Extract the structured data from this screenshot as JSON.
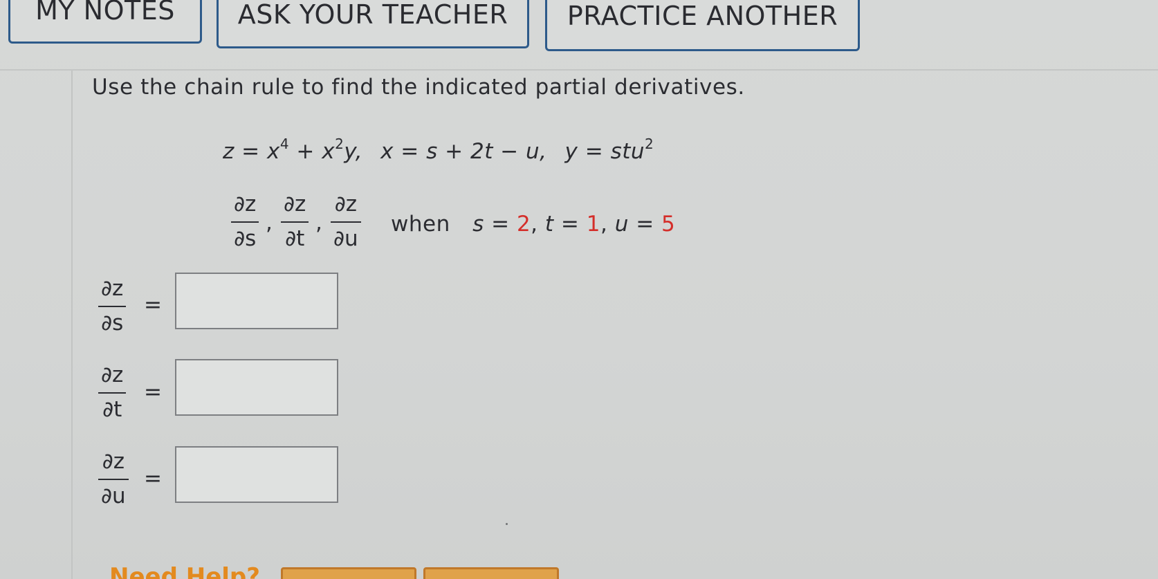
{
  "toolbar": {
    "my_notes": "MY NOTES",
    "ask_teacher": "ASK YOUR TEACHER",
    "practice_another": "PRACTICE ANOTHER"
  },
  "problem": {
    "prompt": "Use the chain rule to find the indicated partial derivatives.",
    "equations": {
      "z_def_lhs": "z = x",
      "z_exp1": "4",
      "z_mid": " + x",
      "z_exp2": "2",
      "z_end": "y,",
      "x_def": "x = s + 2t − u,",
      "y_def": "y = stu",
      "y_exp": "2"
    },
    "partial_symbol": "∂z",
    "denominators": [
      "∂s",
      "∂t",
      "∂u"
    ],
    "when": {
      "label": "when",
      "s_var": "s = ",
      "s_val": "2",
      "t_var": "t = ",
      "t_val": "1",
      "u_var": "u = ",
      "u_val": "5"
    },
    "answers": [
      {
        "label_num": "∂z",
        "label_den": "∂s",
        "equals": "=",
        "value": ""
      },
      {
        "label_num": "∂z",
        "label_den": "∂t",
        "equals": "=",
        "value": ""
      },
      {
        "label_num": "∂z",
        "label_den": "∂u",
        "equals": "=",
        "value": ""
      }
    ]
  },
  "footer": {
    "need_help": "Need Help?"
  },
  "colors": {
    "button_border": "#2d5a8a",
    "highlight_red": "#d42e2a",
    "help_orange": "#e38a1f"
  }
}
